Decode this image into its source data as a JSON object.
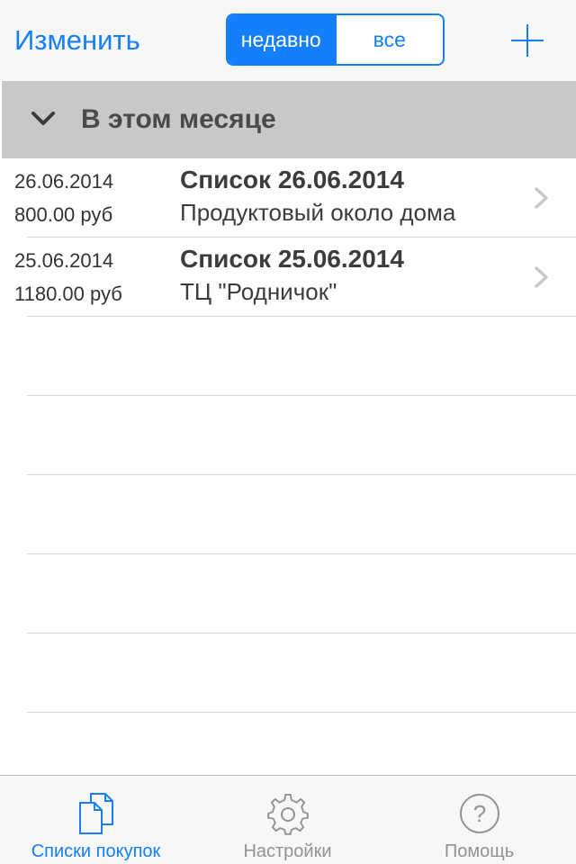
{
  "navbar": {
    "edit_label": "Изменить",
    "segments": [
      {
        "label": "недавно",
        "selected": true
      },
      {
        "label": "все",
        "selected": false
      }
    ],
    "add_icon": "plus-icon"
  },
  "section": {
    "title": "В этом месяце",
    "icon": "chevron-down-icon"
  },
  "lists": [
    {
      "date": "26.06.2014",
      "price": "800.00 руб",
      "title": "Список 26.06.2014",
      "subtitle": "Продуктовый около дома"
    },
    {
      "date": "25.06.2014",
      "price": "1180.00 руб",
      "title": "Список 25.06.2014",
      "subtitle": "ТЦ \"Родничок\""
    }
  ],
  "tabbar": {
    "tabs": [
      {
        "label": "Списки покупок",
        "icon": "documents-icon",
        "active": true
      },
      {
        "label": "Настройки",
        "icon": "gear-icon",
        "active": false
      },
      {
        "label": "Помощь",
        "icon": "help-icon",
        "active": false
      }
    ]
  },
  "colors": {
    "accent": "#157efb",
    "section_bg": "#c8c8c8",
    "tab_inactive": "#929292"
  }
}
